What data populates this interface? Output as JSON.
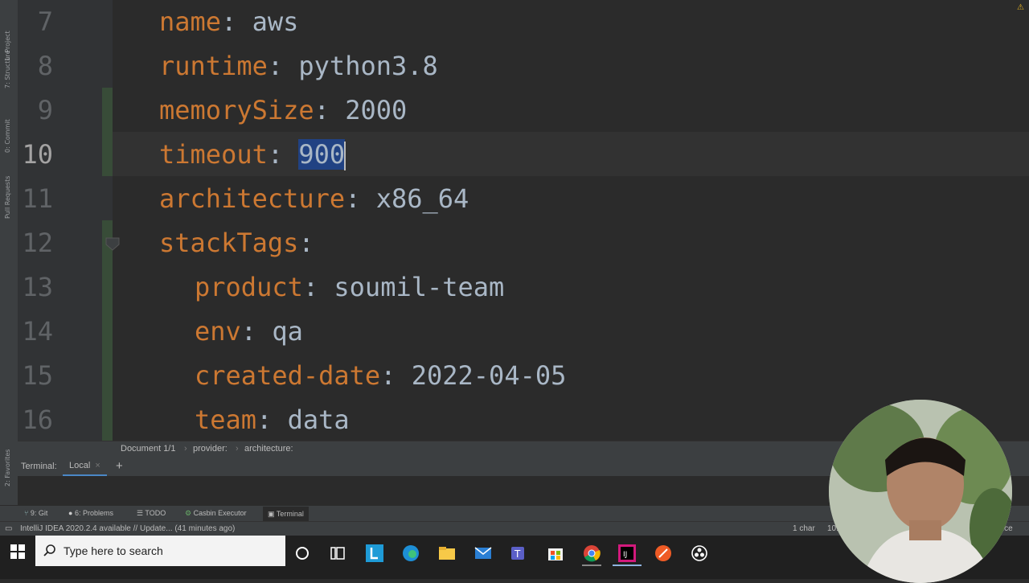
{
  "left_tool_tabs": [
    "1: Project",
    "7: Structure",
    "0: Commit",
    "Pull Requests",
    "2: Favorites"
  ],
  "editor": {
    "lines": [
      {
        "num": "7",
        "indent": "",
        "key": "name",
        "sep": ": ",
        "value": "aws"
      },
      {
        "num": "8",
        "indent": "",
        "key": "runtime",
        "sep": ": ",
        "value": "python3.8"
      },
      {
        "num": "9",
        "indent": "",
        "key": "memorySize",
        "sep": ": ",
        "value": "2000"
      },
      {
        "num": "10",
        "indent": "",
        "key": "timeout",
        "sep": ": ",
        "value": "900",
        "selected": true,
        "current": true
      },
      {
        "num": "11",
        "indent": "",
        "key": "architecture",
        "sep": ": ",
        "value": "x86_64"
      },
      {
        "num": "12",
        "indent": "",
        "key": "stackTags",
        "sep": ":",
        "value": ""
      },
      {
        "num": "13",
        "indent": "  ",
        "key": "product",
        "sep": ": ",
        "value": "soumil-team"
      },
      {
        "num": "14",
        "indent": "  ",
        "key": "env",
        "sep": ": ",
        "value": "qa"
      },
      {
        "num": "15",
        "indent": "  ",
        "key": "created-date",
        "sep": ": ",
        "value": "2022-04-05"
      },
      {
        "num": "16",
        "indent": "  ",
        "key": "team",
        "sep": ": ",
        "value": "data"
      }
    ]
  },
  "breadcrumb": {
    "doc": "Document 1/1",
    "sep": "›",
    "item1": "provider:",
    "item2": "architecture:"
  },
  "terminal": {
    "title": "Terminal:",
    "tab": "Local",
    "close": "×",
    "add": "+"
  },
  "tool_windows": [
    {
      "label": "9: Git"
    },
    {
      "label": "6: Problems"
    },
    {
      "label": "TODO"
    },
    {
      "label": "Casbin Executor"
    },
    {
      "label": "Terminal",
      "active": true
    }
  ],
  "status": {
    "message": "IntelliJ IDEA 2020.2.4 available // Update... (41 minutes ago)",
    "selection": "1 char",
    "position": "10:",
    "right": "ence"
  },
  "taskbar": {
    "search_placeholder": "Type here to search"
  },
  "colors": {
    "key": "#cc7832",
    "value": "#a9b7c6",
    "selection": "#214283",
    "background": "#2b2b2b"
  }
}
